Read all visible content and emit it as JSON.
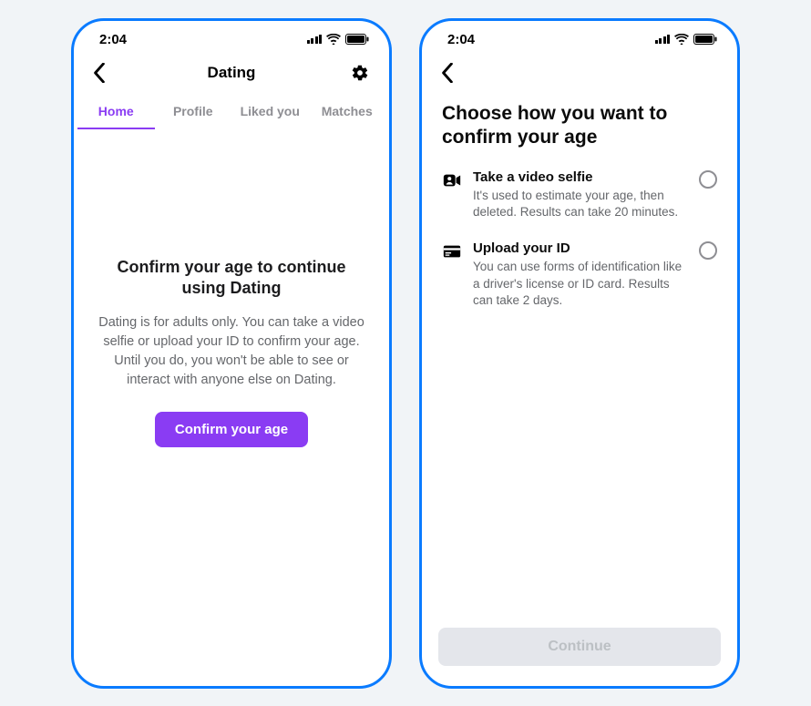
{
  "status": {
    "time": "2:04"
  },
  "screen1": {
    "title": "Dating",
    "tabs": [
      {
        "label": "Home",
        "active": true
      },
      {
        "label": "Profile",
        "active": false
      },
      {
        "label": "Liked you",
        "active": false
      },
      {
        "label": "Matches",
        "active": false
      }
    ],
    "heading": "Confirm your age to continue using Dating",
    "body": "Dating is for adults only. You can take a video selfie or upload your ID to confirm your age. Until you do, you won't be able to see or interact with anyone else on Dating.",
    "button": "Confirm your age"
  },
  "screen2": {
    "heading": "Choose how you want to confirm your age",
    "options": [
      {
        "title": "Take a video selfie",
        "desc": "It's used to estimate your age, then deleted. Results can take 20 minutes."
      },
      {
        "title": "Upload your ID",
        "desc": "You can use forms of identification like a driver's license or ID card. Results can take 2 days."
      }
    ],
    "continue": "Continue"
  }
}
